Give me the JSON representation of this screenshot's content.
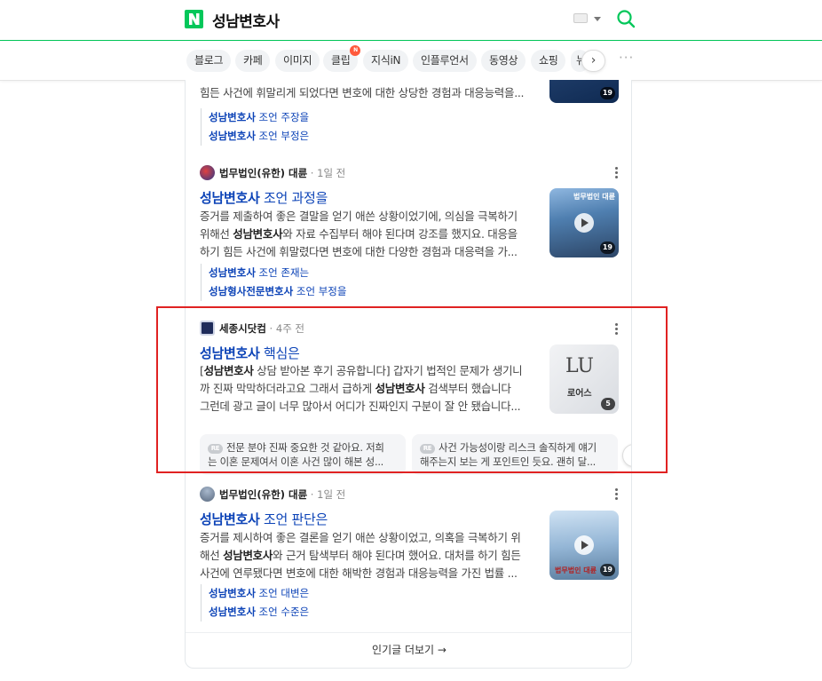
{
  "header": {
    "query": "성남변호사",
    "logo_letter": "N",
    "brand_color": "#03c75a"
  },
  "tabs": {
    "items": [
      {
        "label": "블로그"
      },
      {
        "label": "카페"
      },
      {
        "label": "이미지"
      },
      {
        "label": "클립",
        "badge": "N"
      },
      {
        "label": "지식iN"
      },
      {
        "label": "인플루언서"
      },
      {
        "label": "동영상"
      },
      {
        "label": "쇼핑"
      },
      {
        "label": "뉴"
      }
    ],
    "next_icon": "chevron-right-icon",
    "more_label": "···"
  },
  "top_partial": {
    "desc_lines": [
      "힘든 사건에 휘말리게 되었다면 변호에 대한 상당한 경험과 대응능력을..."
    ],
    "thumb_count": "19",
    "sublinks": [
      {
        "hl": "성남변호사",
        "rest": " 조언 주장을"
      },
      {
        "hl": "성남변호사",
        "rest": " 조언 부정은"
      }
    ]
  },
  "posts": [
    {
      "source": "법무법인(유한) 대륜",
      "date": " · 1일 전",
      "title_hl": "성남변호사",
      "title_rest": " 조언 과정을",
      "desc": [
        "증거를 제출하여 좋은 결말을 얻기 애쓴 상황이었기에, 의심을 극복하기",
        "위해선 성남변호사와 자료 수집부터 해야 된다며 강조를 했지요. 대응을",
        "하기 힘든 사건에 휘말렸다면 변호에 대한 다양한 경험과 대응력을 가..."
      ],
      "thumb_count": "19",
      "thumb_text": "법무법인 대륜",
      "sublinks": [
        {
          "hl": "성남변호사",
          "rest": " 조언 존재는"
        },
        {
          "hl": "성남형사전문변호사",
          "rest": " 조언 부정을"
        }
      ]
    },
    {
      "source": "세종시닷컴",
      "date": " · 4주 전",
      "title_hl": "성남변호사",
      "title_rest": " 핵심은",
      "desc": [
        "[성남변호사 상담 받아본 후기 공유합니다] 갑자기 법적인 문제가 생기니",
        "까 진짜 막막하더라고요 그래서 급하게 성남변호사 검색부터 했습니다",
        "그런데 광고 글이 너무 많아서 어디가 진짜인지 구분이 잘 안 됐습니다..."
      ],
      "thumb_count": "5",
      "thumb_text": "로어스",
      "comments": [
        {
          "badge": "RE",
          "line1": "전문 분야 진짜 중요한 것 같아요. 저희",
          "line2": "는 이혼 문제여서 이혼 사건 많이 해본 성..."
        },
        {
          "badge": "RE",
          "line1": "사건 가능성이랑 리스크 솔직하게 얘기",
          "line2": "해주는지 보는 게 포인트인 듯요. 괜히 달..."
        }
      ]
    },
    {
      "source": "법무법인(유한) 대륜",
      "date": " · 1일 전",
      "title_hl": "성남변호사",
      "title_rest": " 조언 판단은",
      "desc": [
        "증거를 제시하여 좋은 결론을 얻기 애쓴 상황이었고, 의혹을 극복하기 위",
        "해선 성남변호사와 근거 탐색부터 해야 된다며 했어요. 대처를 하기 힘든",
        "사건에 연루됐다면 변호에 대한 해박한 경험과 대응능력을 가진 법률 ..."
      ],
      "thumb_count": "19",
      "thumb_text": "법무법인 대륜",
      "sublinks": [
        {
          "hl": "성남변호사",
          "rest": " 조언 대변은"
        },
        {
          "hl": "성남변호사",
          "rest": " 조언 수준은"
        }
      ]
    }
  ],
  "footer": {
    "more_label": "인기글 더보기 →"
  }
}
